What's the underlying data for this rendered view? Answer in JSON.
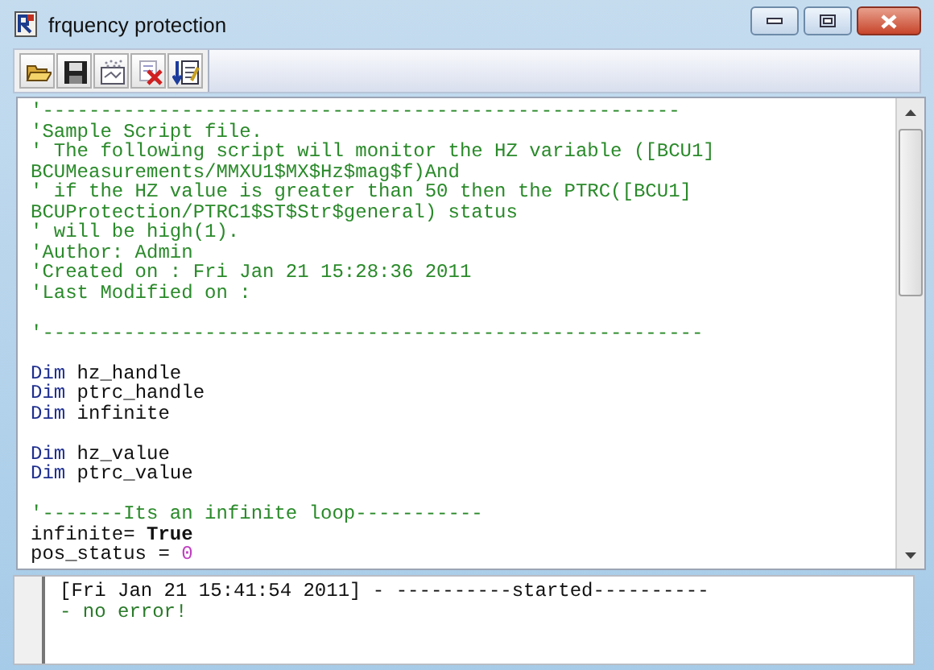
{
  "window": {
    "title": "frquency protection"
  },
  "toolbar": {
    "buttons": [
      {
        "kind": "open"
      },
      {
        "kind": "save"
      },
      {
        "kind": "grid"
      },
      {
        "kind": "delete"
      },
      {
        "kind": "run"
      }
    ]
  },
  "editor": {
    "lines": [
      {
        "kind": "code",
        "segments": [
          {
            "kind": "comment",
            "text": "'-------------------------------------------------------"
          }
        ]
      },
      {
        "kind": "code",
        "segments": [
          {
            "kind": "comment",
            "text": "'Sample Script file."
          }
        ]
      },
      {
        "kind": "code",
        "segments": [
          {
            "kind": "comment",
            "text": "' The following script will monitor the HZ variable ([BCU1]"
          }
        ]
      },
      {
        "kind": "code",
        "segments": [
          {
            "kind": "comment",
            "text": "BCUMeasurements/MMXU1$MX$Hz$mag$f)And"
          }
        ]
      },
      {
        "kind": "code",
        "segments": [
          {
            "kind": "comment",
            "text": "' if the HZ value is greater than 50 then the PTRC([BCU1]"
          }
        ]
      },
      {
        "kind": "code",
        "segments": [
          {
            "kind": "comment",
            "text": "BCUProtection/PTRC1$ST$Str$general) status"
          }
        ]
      },
      {
        "kind": "code",
        "segments": [
          {
            "kind": "comment",
            "text": "' will be high(1)."
          }
        ]
      },
      {
        "kind": "code",
        "segments": [
          {
            "kind": "comment",
            "text": "'Author: Admin"
          }
        ]
      },
      {
        "kind": "code",
        "segments": [
          {
            "kind": "comment",
            "text": "'Created on : Fri Jan 21 15:28:36 2011"
          }
        ]
      },
      {
        "kind": "code",
        "segments": [
          {
            "kind": "comment",
            "text": "'Last Modified on :"
          }
        ]
      },
      {
        "kind": "blank"
      },
      {
        "kind": "code",
        "segments": [
          {
            "kind": "comment",
            "text": "'---------------------------------------------------------"
          }
        ]
      },
      {
        "kind": "blank"
      },
      {
        "kind": "code",
        "segments": [
          {
            "kind": "keyword",
            "text": "Dim"
          },
          {
            "kind": "plain",
            "text": " hz_handle"
          }
        ]
      },
      {
        "kind": "code",
        "segments": [
          {
            "kind": "keyword",
            "text": "Dim"
          },
          {
            "kind": "plain",
            "text": " ptrc_handle"
          }
        ]
      },
      {
        "kind": "code",
        "segments": [
          {
            "kind": "keyword",
            "text": "Dim"
          },
          {
            "kind": "plain",
            "text": " infinite"
          }
        ]
      },
      {
        "kind": "blank"
      },
      {
        "kind": "code",
        "segments": [
          {
            "kind": "keyword",
            "text": "Dim"
          },
          {
            "kind": "plain",
            "text": " hz_value"
          }
        ]
      },
      {
        "kind": "code",
        "segments": [
          {
            "kind": "keyword",
            "text": "Dim"
          },
          {
            "kind": "plain",
            "text": " ptrc_value"
          }
        ]
      },
      {
        "kind": "blank"
      },
      {
        "kind": "code",
        "segments": [
          {
            "kind": "comment",
            "text": "'-------Its an infinite loop-----------"
          }
        ]
      },
      {
        "kind": "code",
        "segments": [
          {
            "kind": "plain",
            "text": "infinite= "
          },
          {
            "kind": "bold",
            "text": "True"
          }
        ]
      },
      {
        "kind": "code",
        "segments": [
          {
            "kind": "plain",
            "text": "pos_status = "
          },
          {
            "kind": "number",
            "text": "0"
          }
        ]
      }
    ]
  },
  "output": {
    "lines": [
      {
        "kind": "info",
        "text": "[Fri Jan 21 15:41:54 2011] - ----------started----------"
      },
      {
        "kind": "success",
        "text": "- no error!"
      }
    ]
  }
}
